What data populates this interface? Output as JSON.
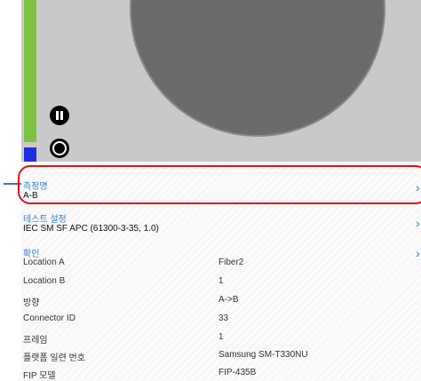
{
  "measurement": {
    "title": "측정명",
    "value": "A-B"
  },
  "test_settings": {
    "title": "테스트 설정",
    "value": "IEC SM SF APC (61300-3-35, 1.0)"
  },
  "confirm": {
    "title": "확인",
    "rows": [
      {
        "label": "Location A",
        "value": "Fiber2"
      },
      {
        "label": "Location B",
        "value": "1"
      },
      {
        "label": "방향",
        "value": "A->B"
      },
      {
        "label": "Connector ID",
        "value": "33"
      },
      {
        "label": "프레임",
        "value": "1"
      },
      {
        "label": "플랫폼 일련 번호",
        "value": "Samsung SM-T330NU"
      },
      {
        "label": "FIP 모델",
        "value": "FIP-435B"
      }
    ]
  },
  "colors": {
    "accent": "#2f7fd4",
    "highlight": "#e0111b",
    "level_bar": "#7dc242",
    "indicator": "#1f2fe0"
  },
  "icons": {
    "pause": "pause-icon",
    "record": "record-icon",
    "chevron": "chevron-right-icon"
  }
}
